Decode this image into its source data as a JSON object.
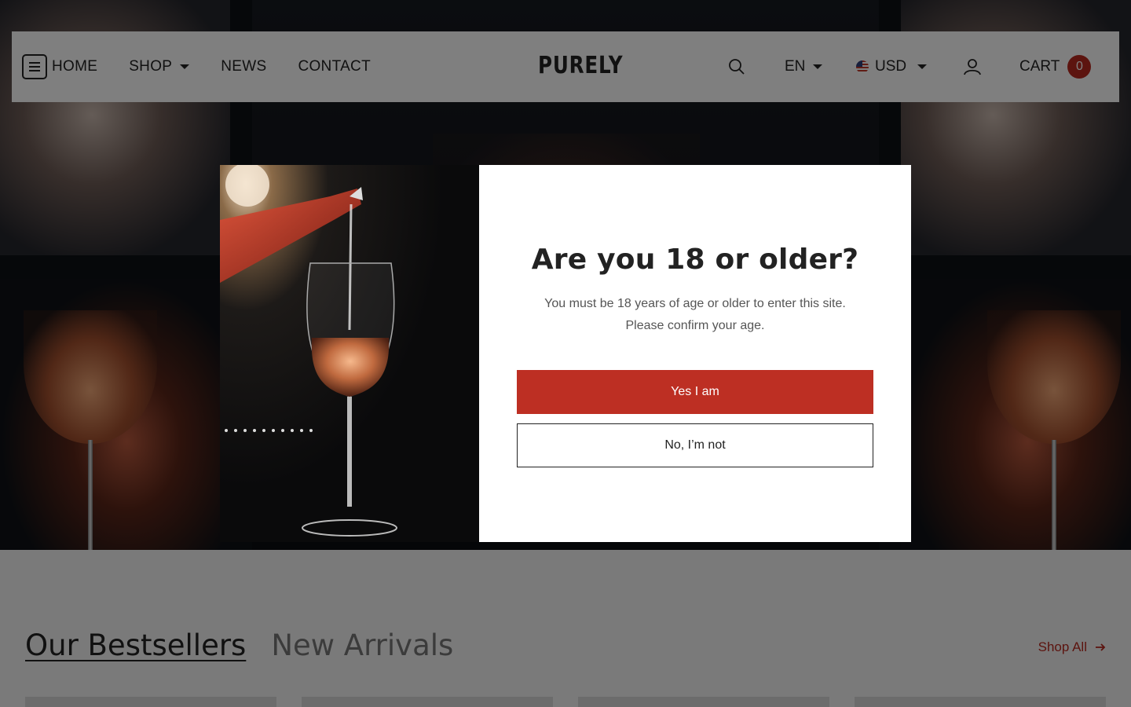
{
  "header": {
    "nav": [
      {
        "label": "HOME"
      },
      {
        "label": "SHOP"
      },
      {
        "label": "NEWS"
      },
      {
        "label": "CONTACT"
      }
    ],
    "logo": "PURELY",
    "language": "EN",
    "currency": "USD",
    "cart_label": "CART",
    "cart_count": "0"
  },
  "collections": {
    "tabs": [
      {
        "label": "Our Bestsellers",
        "active": true
      },
      {
        "label": "New Arrivals",
        "active": false
      }
    ],
    "shop_all": "Shop All"
  },
  "age_modal": {
    "title": "Are you 18 or older?",
    "text_line1": "You must be 18 years of age or older to enter this site.",
    "text_line2": "Please confirm your age.",
    "yes_label": "Yes I am",
    "no_label": "No, I’m not"
  },
  "colors": {
    "accent": "#bd2f23",
    "text": "#222222"
  }
}
